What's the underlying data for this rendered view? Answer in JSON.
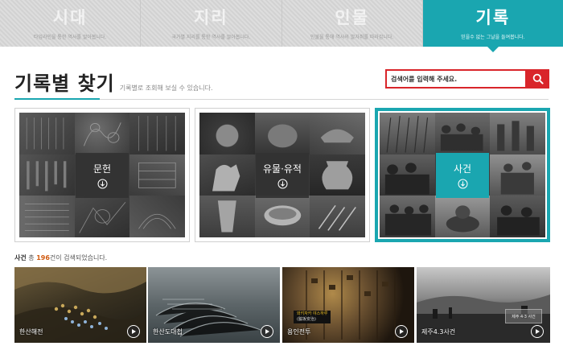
{
  "nav": {
    "tabs": [
      {
        "title": "시대",
        "desc": "타임라인을 통한 역사를 알아봅니다.",
        "active": false
      },
      {
        "title": "지리",
        "desc": "국가별 지리를 통한 역사를 알아봅니다.",
        "active": false
      },
      {
        "title": "인물",
        "desc": "인물을 통해 역사의 발자취를 따라갑니다.",
        "active": false
      },
      {
        "title": "기록",
        "desc": "믿을수 없는 그날을 들여봅니다.",
        "active": true
      }
    ]
  },
  "header": {
    "title": "기록별 찾기",
    "subtitle": "기록별로 조회해 보실 수 있습니다."
  },
  "search": {
    "placeholder": "검색어를 입력해 주세요.",
    "icon": "search-icon"
  },
  "categories": [
    {
      "label": "문헌",
      "icon": "arrow-down-circle-icon",
      "active": false
    },
    {
      "label": "유물·유적",
      "icon": "arrow-down-circle-icon",
      "active": false
    },
    {
      "label": "사건",
      "icon": "arrow-down-circle-icon",
      "active": true
    }
  ],
  "results": {
    "category": "사건",
    "mid1": " 총 ",
    "count": "196",
    "suffix": "건이 검색되었습니다."
  },
  "events": [
    {
      "title": "한산해전",
      "icon": "play-icon"
    },
    {
      "title": "한산도대첩",
      "icon": "play-icon"
    },
    {
      "title": "용인전투",
      "icon": "play-icon",
      "caption_line1": "와키자카 야스하루",
      "caption_line2": "(脇坂安治)"
    },
    {
      "title": "제주4.3사건",
      "icon": "play-icon",
      "inner_sign": "제주 4·3 사건"
    }
  ],
  "colors": {
    "accent": "#1aa6b0",
    "search_red": "#d9252a",
    "count_orange": "#d05a10"
  }
}
